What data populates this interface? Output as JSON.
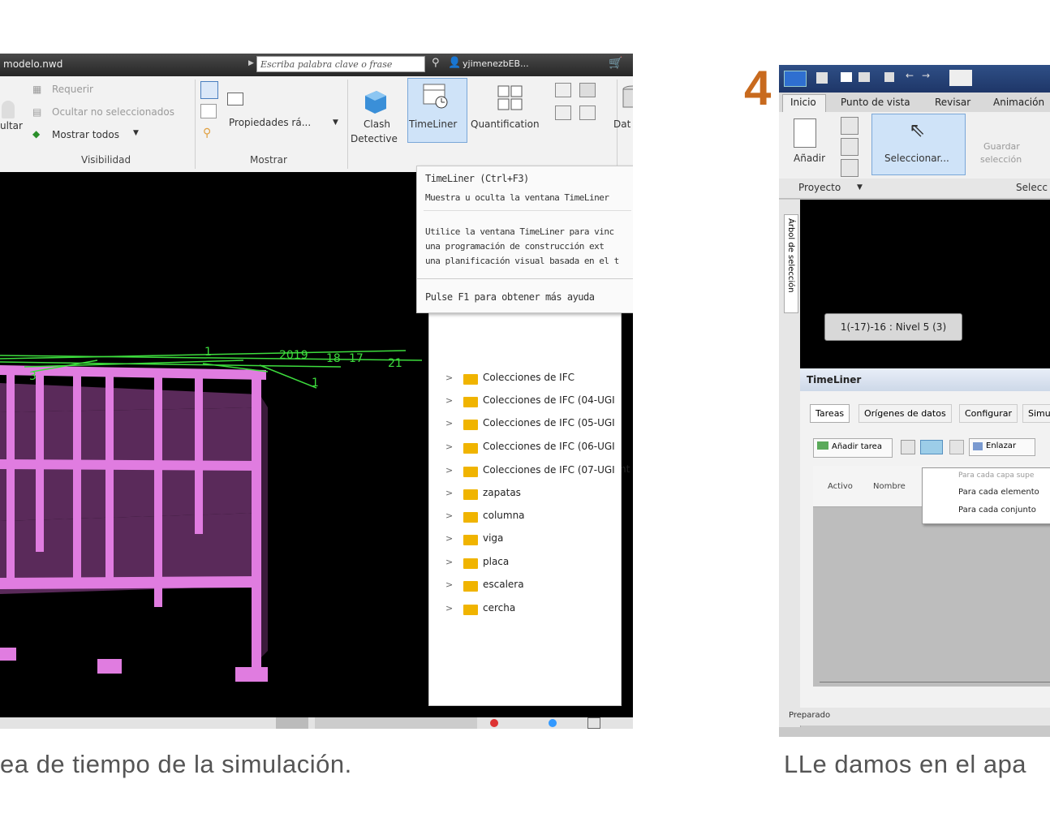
{
  "left_screenshot": {
    "title_file": "modelo.nwd",
    "search_placeholder": "Escriba palabra clave o frase",
    "username": "yjimenezbEB...",
    "ribbon": {
      "visibilidad": {
        "label": "Visibilidad",
        "cut_label": "ultar",
        "items": [
          "Requerir",
          "Ocultar no seleccionados",
          "Mostrar todos"
        ]
      },
      "mostrar": {
        "label": "Mostrar",
        "propiedades": "Propiedades rá..."
      },
      "tools": {
        "clash_line1": "Clash",
        "clash_line2": "Detective",
        "timeliner": "TimeLiner",
        "quantification": "Quantification",
        "dat": "Dat"
      }
    },
    "tooltip": {
      "title": "TimeLiner (Ctrl+F3)",
      "line1": "Muestra u oculta la ventana TimeLiner",
      "para1": "Utilice la ventana TimeLiner para vinc",
      "para2": "una programación de construcción ext",
      "para3": "una planificación visual basada en el t",
      "help": "Pulse F1 para obtener más ayuda"
    },
    "grid_labels": [
      "1",
      "2019",
      "18",
      "17",
      "21",
      "1",
      "3"
    ],
    "panel_items": [
      "Colecciones de IFC",
      "Colecciones de IFC (04-UGI",
      "Colecciones de IFC (05-UGI",
      "Colecciones de IFC (06-UGI",
      "Colecciones de IFC (07-UGI",
      "zapatas",
      "columna",
      "viga",
      "placa",
      "escalera",
      "cercha"
    ],
    "side_cut_text": "nt"
  },
  "right_screenshot": {
    "step_number": "4",
    "tabs": [
      "Inicio",
      "Punto de vista",
      "Revisar",
      "Animación"
    ],
    "ribbon": {
      "anadir": "Añadir",
      "seleccionar": "Seleccionar...",
      "guardar_line1": "Guardar",
      "guardar_line2": "selección",
      "proyecto": "Proyecto",
      "selec": "Selecc"
    },
    "side_tab": "Árbol de selección",
    "badge": "1(-17)-16 : Nivel 5 (3)",
    "timeliner": {
      "title": "TimeLiner",
      "tabs": [
        "Tareas",
        "Orígenes de datos",
        "Configurar",
        "Simula"
      ],
      "add_task": "Añadir tarea",
      "link": "Enlazar",
      "col_activo": "Activo",
      "col_nombre": "Nombre",
      "menu": [
        "Para cada capa supe",
        "Para cada elemento",
        "Para cada conjunto"
      ]
    },
    "status": "Preparado"
  },
  "captions": {
    "left": "ea de tiempo de la simulación.",
    "right": "LLe damos en el apa"
  },
  "colors": {
    "structure": "#e07ce0",
    "slab": "#5a2a5a",
    "grid_lines": "#3ddc3d",
    "accent_orange": "#c86a1e",
    "folder": "#f0b400"
  }
}
